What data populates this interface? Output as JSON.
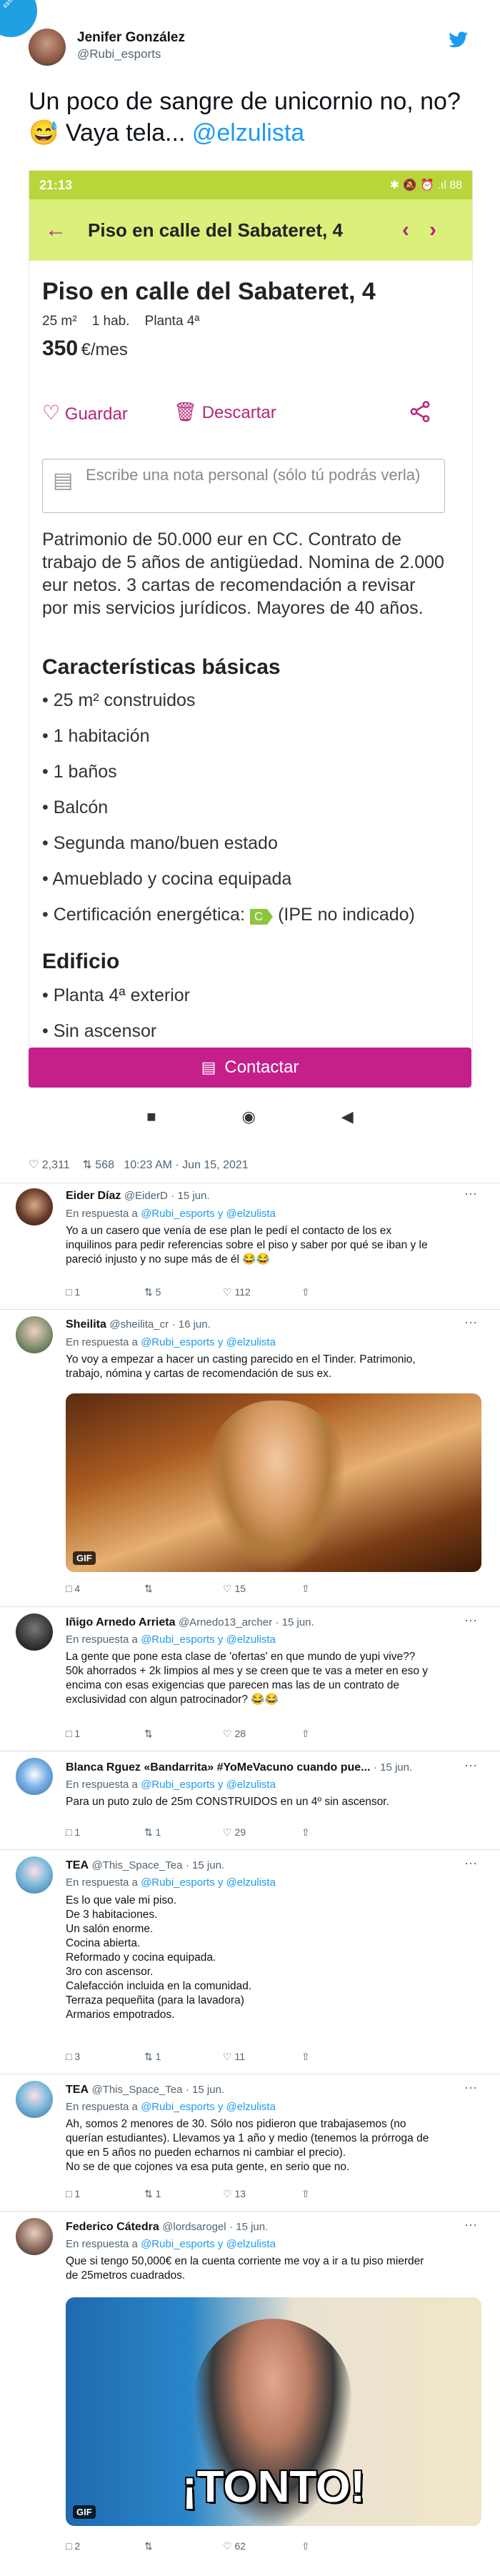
{
  "watermark": "ESTASCOSASPASAN",
  "tweet": {
    "author_name": "Jenifer González",
    "author_handle": "@Rubi_esports",
    "text_line1": "Un poco de sangre de unicornio no, no?",
    "text_line2_emoji": "😅",
    "text_line2": "Vaya tela...",
    "mention": "@elzulista",
    "stats_likes": "2,311",
    "stats_retweets": "568",
    "stats_time": "10:23 AM · Jun 15, 2021"
  },
  "phone": {
    "time": "21:13",
    "status_icons": "✱ 🔕 ⏰ .ıl 88",
    "appbar_title": "Piso en calle del Sabateret, 4",
    "listing_title": "Piso en calle del Sabateret, 4",
    "specs": [
      "25 m²",
      "1 hab.",
      "Planta 4ª"
    ],
    "price": "350",
    "price_unit": "€/mes",
    "save_label": "Guardar",
    "discard_label": "Descartar",
    "note_placeholder": "Escribe una nota personal (sólo tú podrás verla)",
    "description": [
      "Patrimonio de 50.000 eur en CC. Contrato de",
      "trabajo de 5 años de antigüedad. Nomina de 2.000",
      "eur netos. 3 cartas de recomendación a revisar",
      "por mis servicios jurídicos. Mayores de 40 años."
    ],
    "features_title": "Características básicas",
    "features": [
      "• 25 m² construidos",
      "• 1 habitación",
      "• 1 baños",
      "• Balcón",
      "• Segunda mano/buen estado",
      "• Amueblado y cocina equipada"
    ],
    "energy_label": "• Certificación energética:",
    "energy_badge": "C",
    "energy_value": "(IPE no indicado)",
    "building_title": "Edificio",
    "building": [
      "• Planta 4ª exterior",
      "• Sin ascensor"
    ],
    "contact_label": "Contactar",
    "colors": {
      "status": "#b8d63a",
      "appbar": "#dbf07a",
      "accent": "#b5267a",
      "contact": "#c51f8a",
      "energy": "#8cc63f"
    }
  },
  "replies": [
    {
      "name": "Eider Díaz",
      "handle": "@EiderD",
      "time": "· 15 jun.",
      "in_reply": "En respuesta a",
      "mentions": "@Rubi_esports y @elzulista",
      "body": [
        "Yo a un casero que venía de ese plan le pedí el contacto de los ex",
        "inquilinos para pedir referencias sobre el piso y saber por qué se iban y le",
        "pareció injusto y no supe más de él 😂😂"
      ],
      "replies": "1",
      "retweets": "5",
      "likes": "112"
    },
    {
      "name": "Sheilita",
      "handle": "@sheilita_cr",
      "time": "· 16 jun.",
      "in_reply": "En respuesta a",
      "mentions": "@Rubi_esports y @elzulista",
      "body": [
        "Yo voy a empezar a hacer un casting parecido en el Tinder. Patrimonio,",
        "trabajo, nómina y cartas de recomendación de sus ex."
      ],
      "gif_label": "GIF",
      "replies": "4",
      "retweets": "",
      "likes": "15"
    },
    {
      "name": "Iñigo Arnedo Arrieta",
      "handle": "@Arnedo13_archer",
      "time": "· 15 jun.",
      "in_reply": "En respuesta a",
      "mentions": "@Rubi_esports y @elzulista",
      "body": [
        "La gente que pone esta clase de 'ofertas' en que mundo de yupi vive??",
        "50k ahorrados + 2k limpios al mes y se creen que te vas a meter en eso y",
        "encima con esas exigencias que parecen mas las de un contrato de",
        "exclusividad con algun patrocinador? 😂😂"
      ],
      "replies": "1",
      "retweets": "",
      "likes": "28"
    },
    {
      "name": "Blanca Rguez «Bandarrita» #YoMeVacuno cuando pue...",
      "handle": "",
      "time": "· 15 jun.",
      "in_reply": "En respuesta a",
      "mentions": "@Rubi_esports y @elzulista",
      "body": [
        "Para un puto zulo de 25m CONSTRUIDOS en un 4º sin ascensor."
      ],
      "replies": "1",
      "retweets": "1",
      "likes": "29"
    },
    {
      "name": "TEA",
      "handle": "@This_Space_Tea",
      "time": "· 15 jun.",
      "in_reply": "En respuesta a",
      "mentions": "@Rubi_esports y @elzulista",
      "body": [
        "Es lo que vale mi piso.",
        "De 3 habitaciones.",
        "Un salón enorme.",
        "Cocina abierta.",
        "Reformado y cocina equipada.",
        "3ro con ascensor.",
        "Calefacción incluida en la comunidad.",
        "Terraza pequeñita (para la lavadora)",
        "Armarios empotrados."
      ],
      "replies": "3",
      "retweets": "1",
      "likes": "11"
    },
    {
      "name": "TEA",
      "handle": "@This_Space_Tea",
      "time": "· 15 jun.",
      "in_reply": "En respuesta a",
      "mentions": "@Rubi_esports y @elzulista",
      "body": [
        "Ah, somos 2 menores de 30. Sólo nos pidieron que trabajasemos (no",
        "querían estudiantes). Llevamos ya 1 año y medio (tenemos la prórroga de",
        "que en 5 años no pueden echarnos ni cambiar el precio).",
        "No se de que cojones va esa puta gente, en serio que no."
      ],
      "replies": "1",
      "retweets": "1",
      "likes": "13"
    },
    {
      "name": "Federico Cátedra",
      "handle": "@lordsarogel",
      "time": "· 15 jun.",
      "in_reply": "En respuesta a",
      "mentions": "@Rubi_esports y @elzulista",
      "body": [
        "Que si tengo 50,000€ en la cuenta corriente me voy a ir a tu piso mierder",
        "de 25metros cuadrados."
      ],
      "gif_label": "GIF",
      "gif_text": "¡TONTO!",
      "replies": "2",
      "retweets": "",
      "likes": "62"
    }
  ]
}
